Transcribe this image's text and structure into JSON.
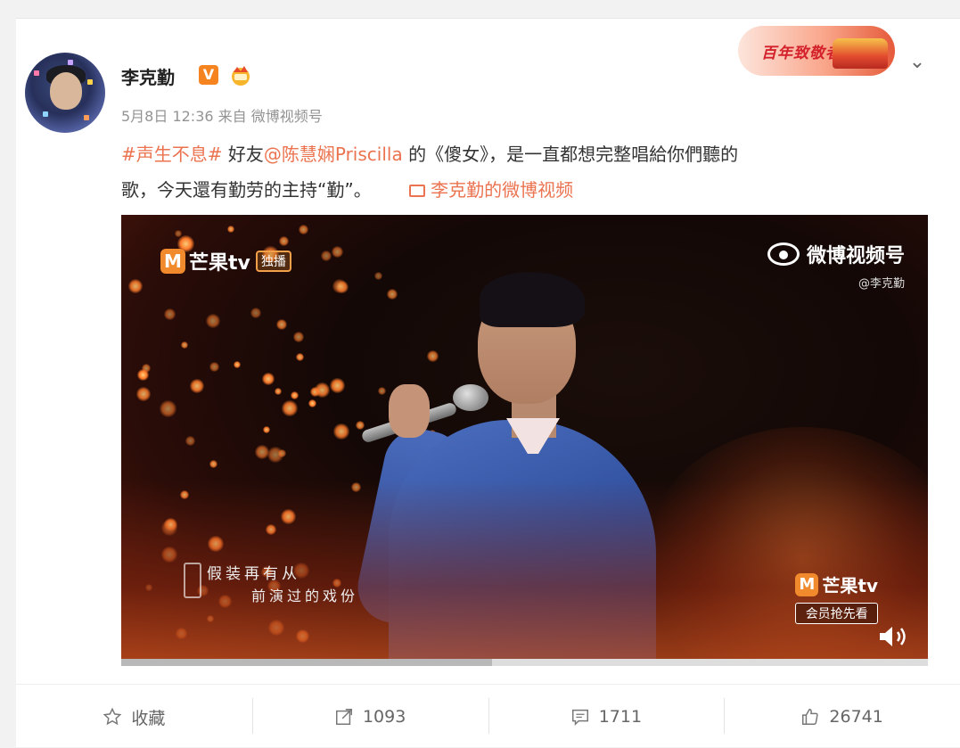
{
  "post": {
    "username": "李克勤",
    "verified_badge": "V",
    "meta": "5月8日 12:36 来自 微博视频号",
    "hashtag": "#声生不息#",
    "text_1": " 好友",
    "mention": "@陈慧娴Priscilla",
    "text_2": " 的《傻女》，是一直都想完整唱給你們聽的",
    "text_3": "歌，今天還有勤劳的主持“勤”。",
    "video_link": "李克勤的微博视频"
  },
  "banner": {
    "text": "百年致敬者"
  },
  "video": {
    "watermark_left": {
      "brand": "芒果tv",
      "tag": "独播"
    },
    "watermark_right": {
      "brand": "微博视频号",
      "handle": "@李克勤"
    },
    "subtitle_line1": "假装再有从",
    "subtitle_line2": "前演过的戏份",
    "corner_brand": "芒果tv",
    "corner_badge": "会员抢先看",
    "progress": 0.46
  },
  "actions": {
    "favorite": "收藏",
    "repost": "1093",
    "comment": "1711",
    "like": "26741"
  },
  "icons": {
    "avatar": "avatar-image",
    "crown": "crown-icon",
    "chevron": "chevron-down-icon",
    "star": "star-icon",
    "share": "share-icon",
    "comment": "comment-icon",
    "thumb": "thumb-up-icon",
    "speaker": "speaker-icon",
    "video": "video-icon"
  },
  "colors": {
    "accent": "#eb7350",
    "brand_orange": "#f08a2c"
  }
}
